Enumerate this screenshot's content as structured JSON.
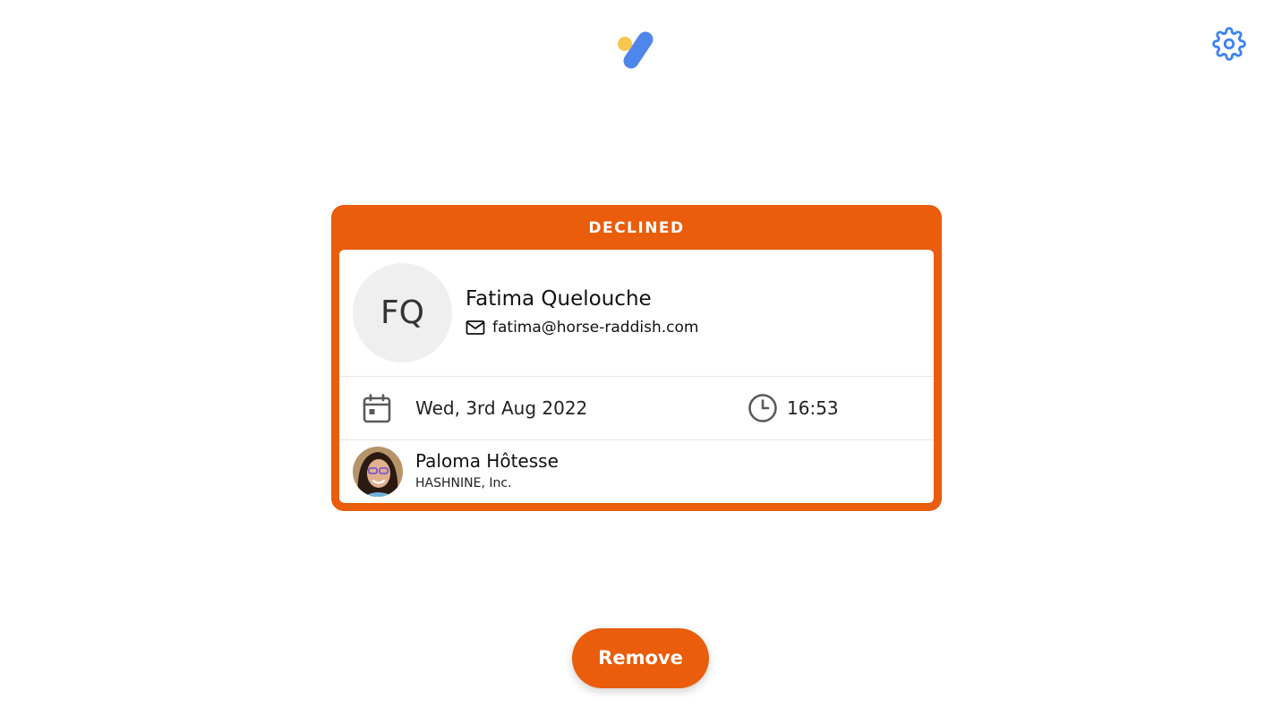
{
  "header": {
    "logo_icon": "app-logo-icon",
    "settings_icon": "gear-icon",
    "colors": {
      "logo_blue": "#4f86ec",
      "logo_yellow": "#f9c74f",
      "settings_blue": "#3b82f6"
    }
  },
  "card": {
    "status": "DECLINED",
    "status_color": "#e95d0c",
    "visitor": {
      "initials": "FQ",
      "name": "Fatima Quelouche",
      "email": "fatima@horse-raddish.com",
      "email_icon": "mail-icon"
    },
    "schedule": {
      "date": "Wed, 3rd Aug 2022",
      "date_icon": "calendar-icon",
      "time": "16:53",
      "time_icon": "clock-icon"
    },
    "host": {
      "name": "Paloma Hôtesse",
      "company": "HASHNINE, Inc.",
      "avatar": "host-photo"
    }
  },
  "actions": {
    "remove_label": "Remove"
  }
}
